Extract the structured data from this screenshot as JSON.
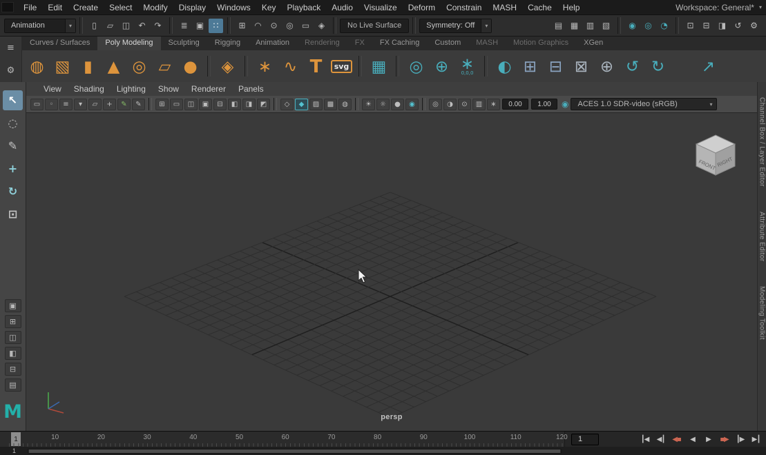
{
  "ui": {
    "caret": "▾"
  },
  "colors": {
    "accent_teal": "#49aebc",
    "shelf_orange": "#dd943c",
    "selection_blue": "#4d7a97",
    "viewport_bg": "#3a3a3a"
  },
  "menubar": {
    "items": [
      {
        "label": "File"
      },
      {
        "label": "Edit"
      },
      {
        "label": "Create"
      },
      {
        "label": "Select"
      },
      {
        "label": "Modify"
      },
      {
        "label": "Display"
      },
      {
        "label": "Windows"
      },
      {
        "label": "Key"
      },
      {
        "label": "Playback"
      },
      {
        "label": "Audio"
      },
      {
        "label": "Visualize"
      },
      {
        "label": "Deform"
      },
      {
        "label": "Constrain"
      },
      {
        "label": "MASH"
      },
      {
        "label": "Cache"
      },
      {
        "label": "Help"
      }
    ],
    "workspace_label": "Workspace: General*"
  },
  "statusline": {
    "menuset": {
      "value": "Animation"
    },
    "file_icons": [
      {
        "name": "new-scene-icon",
        "glyph": "▯"
      },
      {
        "name": "open-scene-icon",
        "glyph": "▱"
      },
      {
        "name": "save-scene-icon",
        "glyph": "◫"
      }
    ],
    "history_icons": [
      {
        "name": "undo-icon",
        "glyph": "↶"
      },
      {
        "name": "redo-icon",
        "glyph": "↷"
      }
    ],
    "selection_icons": [
      {
        "name": "select-hierarchy-icon",
        "glyph": "≣"
      },
      {
        "name": "select-object-icon",
        "glyph": "▣"
      },
      {
        "name": "select-component-icon",
        "glyph": "∷",
        "active": true
      }
    ],
    "snap_icons": [
      {
        "name": "snap-to-grid-icon",
        "glyph": "⊞"
      },
      {
        "name": "snap-to-curve-icon",
        "glyph": "◠"
      },
      {
        "name": "snap-to-point-icon",
        "glyph": "⊙"
      },
      {
        "name": "snap-to-projected-center-icon",
        "glyph": "◎"
      },
      {
        "name": "snap-to-view-plane-icon",
        "glyph": "▭"
      },
      {
        "name": "make-object-live-icon",
        "glyph": "◈"
      }
    ],
    "live_surface": "No Live Surface",
    "symmetry": {
      "value": "Symmetry: Off"
    },
    "render_icons": [
      {
        "name": "render-view-icon",
        "glyph": "▤"
      },
      {
        "name": "render-current-frame-icon",
        "glyph": "▦"
      },
      {
        "name": "ipr-render-icon",
        "glyph": "▥"
      },
      {
        "name": "render-settings-icon",
        "glyph": "▧"
      }
    ],
    "display_icons": [
      {
        "name": "hypershade-icon",
        "glyph": "◉",
        "color": "#49aebc"
      },
      {
        "name": "light-editor-icon",
        "glyph": "◎",
        "color": "#49aebc"
      },
      {
        "name": "render-setup-icon",
        "glyph": "◔",
        "color": "#49aebc"
      }
    ],
    "tool_icons": [
      {
        "name": "paint-effects-icon",
        "glyph": "⊡"
      },
      {
        "name": "content-browser-icon",
        "glyph": "⊟"
      },
      {
        "name": "toolbox-icon",
        "glyph": "◨"
      },
      {
        "name": "construction-history-icon",
        "glyph": "↺"
      },
      {
        "name": "settings-icon",
        "glyph": "⚙"
      }
    ]
  },
  "shelf": {
    "left_icons": [
      {
        "name": "shelf-menu-icon",
        "glyph": "≡"
      },
      {
        "name": "shelf-gear-icon",
        "glyph": "⚙"
      }
    ],
    "tabs": [
      {
        "label": "Curves / Surfaces"
      },
      {
        "label": "Poly Modeling",
        "active": true
      },
      {
        "label": "Sculpting"
      },
      {
        "label": "Rigging"
      },
      {
        "label": "Animation"
      },
      {
        "label": "Rendering",
        "dim": true
      },
      {
        "label": "FX",
        "dim": true
      },
      {
        "label": "FX Caching"
      },
      {
        "label": "Custom"
      },
      {
        "label": "MASH",
        "dim": true
      },
      {
        "label": "Motion Graphics",
        "dim": true
      },
      {
        "label": "XGen"
      }
    ],
    "icons": [
      {
        "name": "poly-sphere-icon",
        "glyph": "◍",
        "color": "#dd943c"
      },
      {
        "name": "poly-cube-icon",
        "glyph": "▧",
        "color": "#dd943c"
      },
      {
        "name": "poly-cylinder-icon",
        "glyph": "▮",
        "color": "#dd943c"
      },
      {
        "name": "poly-cone-icon",
        "glyph": "▲",
        "color": "#dd943c"
      },
      {
        "name": "poly-torus-icon",
        "glyph": "◎",
        "color": "#dd943c"
      },
      {
        "name": "poly-plane-icon",
        "glyph": "▱",
        "color": "#dd943c"
      },
      {
        "name": "poly-disc-icon",
        "glyph": "●",
        "color": "#dd943c"
      },
      {
        "cls": "sep"
      },
      {
        "name": "platonic-solid-icon",
        "glyph": "◈",
        "color": "#dd943c"
      },
      {
        "cls": "sep"
      },
      {
        "name": "create-polygon-icon",
        "glyph": "∗",
        "color": "#dd943c"
      },
      {
        "name": "sweep-mesh-icon",
        "glyph": "∿",
        "color": "#dd943c"
      },
      {
        "name": "type-tool-icon",
        "glyph": "T",
        "cls": "serif",
        "color": "#dd943c"
      },
      {
        "name": "svg-tool-icon",
        "glyph": "svg",
        "cls": "badge",
        "color": "#dd943c"
      },
      {
        "cls": "sep"
      },
      {
        "name": "uv-editor-icon",
        "glyph": "▦",
        "color": "#49aebc"
      },
      {
        "cls": "sep"
      },
      {
        "name": "make-live-icon",
        "glyph": "◎",
        "color": "#49aebc"
      },
      {
        "name": "center-pivot-icon",
        "glyph": "⊕",
        "color": "#49aebc"
      },
      {
        "name": "move-to-origin-icon",
        "glyph": "∗",
        "sub": "0,0,0",
        "color": "#49aebc"
      },
      {
        "cls": "sep"
      },
      {
        "name": "boolean-icon",
        "glyph": "◐",
        "color": "#49aebc"
      },
      {
        "name": "combine-icon",
        "glyph": "⊞",
        "color": "#8aa3c0"
      },
      {
        "name": "separate-icon",
        "glyph": "⊟",
        "color": "#8aa3c0"
      },
      {
        "name": "extract-icon",
        "glyph": "⊠",
        "color": "#a8b2bc"
      },
      {
        "name": "merge-vertices-icon",
        "glyph": "⊕",
        "color": "#a8b2bc"
      },
      {
        "name": "mirror-left-icon",
        "glyph": "↺",
        "color": "#49aebc"
      },
      {
        "name": "mirror-right-icon",
        "glyph": "↻",
        "color": "#49aebc"
      },
      {
        "cls": "gap"
      },
      {
        "name": "curve-warp-icon",
        "glyph": "↗",
        "color": "#49aebc"
      }
    ]
  },
  "toolbox": {
    "tools": [
      {
        "name": "select-tool",
        "glyph": "↖",
        "active": true
      },
      {
        "name": "lasso-select-tool",
        "glyph": "◌"
      },
      {
        "name": "paint-select-tool",
        "glyph": "✎"
      },
      {
        "name": "move-tool",
        "glyph": "+",
        "color": "#8fd0da"
      },
      {
        "name": "rotate-tool",
        "glyph": "↻",
        "color": "#8fd0da"
      },
      {
        "name": "scale-tool",
        "glyph": "⊡"
      }
    ],
    "layouts": [
      {
        "name": "layout-single-pane",
        "glyph": "▣"
      },
      {
        "name": "layout-four-pane",
        "glyph": "⊞"
      },
      {
        "name": "layout-two-pane",
        "glyph": "◫"
      },
      {
        "name": "layout-persp-outliner",
        "glyph": "◧"
      },
      {
        "name": "layout-split-horizontal",
        "glyph": "⊟"
      },
      {
        "name": "layout-hypershade",
        "glyph": "▤"
      }
    ],
    "logo": "M"
  },
  "panel": {
    "menus": [
      "View",
      "Shading",
      "Lighting",
      "Show",
      "Renderer",
      "Panels"
    ],
    "cam_icons": [
      {
        "name": "select-camera-icon",
        "glyph": "▭"
      },
      {
        "name": "lock-camera-icon",
        "glyph": "◦"
      },
      {
        "name": "camera-attributes-icon",
        "glyph": "≡"
      },
      {
        "name": "bookmarks-icon",
        "glyph": "▾"
      },
      {
        "name": "image-plane-icon",
        "glyph": "▱"
      },
      {
        "name": "two-d-pan-zoom-icon",
        "glyph": "+"
      },
      {
        "name": "grease-pencil-icon",
        "glyph": "✎",
        "color": "#86bb66"
      },
      {
        "name": "annotate-icon",
        "glyph": "✎"
      }
    ],
    "gate_icons": [
      {
        "name": "grid-toggle-icon",
        "glyph": "⊞"
      },
      {
        "name": "film-gate-icon",
        "glyph": "▭"
      },
      {
        "name": "resolution-gate-icon",
        "glyph": "◫"
      },
      {
        "name": "gate-mask-icon",
        "glyph": "▣"
      },
      {
        "name": "field-chart-icon",
        "glyph": "⊟"
      },
      {
        "name": "safe-action-icon",
        "glyph": "◧"
      },
      {
        "name": "safe-title-icon",
        "glyph": "◨"
      },
      {
        "name": "fill-mode-icon",
        "glyph": "◩"
      }
    ],
    "shade_icons": [
      {
        "name": "wireframe-icon",
        "glyph": "◇"
      },
      {
        "name": "shaded-mode-icon",
        "glyph": "◆",
        "active": true,
        "color": "#54c2d0"
      },
      {
        "name": "textured-mode-icon",
        "glyph": "▨"
      },
      {
        "name": "material-override-icon",
        "glyph": "▩"
      },
      {
        "name": "wireframe-on-shaded-icon",
        "glyph": "◍"
      }
    ],
    "light_icons": [
      {
        "name": "default-lighting-icon",
        "glyph": "☀"
      },
      {
        "name": "all-lights-icon",
        "glyph": "☼"
      },
      {
        "name": "shadows-icon",
        "glyph": "●"
      },
      {
        "name": "occlusion-icon",
        "glyph": "◉",
        "color": "#54c2d0"
      }
    ],
    "misc_icons": [
      {
        "name": "isolate-select-icon",
        "glyph": "◎"
      },
      {
        "name": "xray-icon",
        "glyph": "◑"
      },
      {
        "name": "joints-xray-icon",
        "glyph": "⊙"
      },
      {
        "name": "plane-slice-icon",
        "glyph": "▥"
      },
      {
        "name": "exposure-icon",
        "glyph": "∗"
      }
    ],
    "exposure": "0.00",
    "gamma": "1.00",
    "view_transform": "ACES 1.0 SDR-video (sRGB)"
  },
  "viewport": {
    "camera_label": "persp",
    "viewcube": {
      "front": "FRONT",
      "right": "RIGHT"
    },
    "grid": {
      "divisions": 12
    }
  },
  "side_tabs": [
    "Channel Box / Layer Editor",
    "Attribute Editor",
    "Modeling Toolkit"
  ],
  "timeline": {
    "ticks": [
      10,
      20,
      30,
      40,
      50,
      60,
      70,
      80,
      90,
      100,
      110,
      120
    ],
    "playhead": "1",
    "current_frame": "1",
    "playback": [
      {
        "name": "go-to-start-button",
        "glyph": "┃◀"
      },
      {
        "name": "step-back-frame-button",
        "glyph": "◀┃"
      },
      {
        "name": "step-back-key-button",
        "glyph": "◀▪",
        "color": "#cd6652"
      },
      {
        "name": "play-backwards-button",
        "glyph": "◀"
      },
      {
        "name": "play-forwards-button",
        "glyph": "▶"
      },
      {
        "name": "step-forward-key-button",
        "glyph": "▪▶",
        "color": "#cd6652"
      },
      {
        "name": "step-forward-frame-button",
        "glyph": "┃▶"
      },
      {
        "name": "go-to-end-button",
        "glyph": "▶┃"
      }
    ]
  },
  "range_slider": {
    "start": "1"
  }
}
